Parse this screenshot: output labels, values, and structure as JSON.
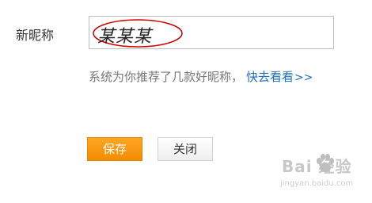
{
  "form": {
    "nickname_label": "新昵称",
    "nickname_value": "某某某",
    "suggestion_text": "系统为你推荐了几款好昵称，",
    "suggestion_link": "快去看看",
    "suggestion_arrow": ">>",
    "save_label": "保存",
    "close_label": "关闭"
  },
  "watermark": {
    "brand": "Bai 经验",
    "domain": "jingyan.baidu.com"
  },
  "colors": {
    "accent_orange": "#f39800",
    "link_blue": "#1e6fc1",
    "annotation_red": "#d00000"
  },
  "icons": {
    "watermark_paw": "paw-icon"
  }
}
